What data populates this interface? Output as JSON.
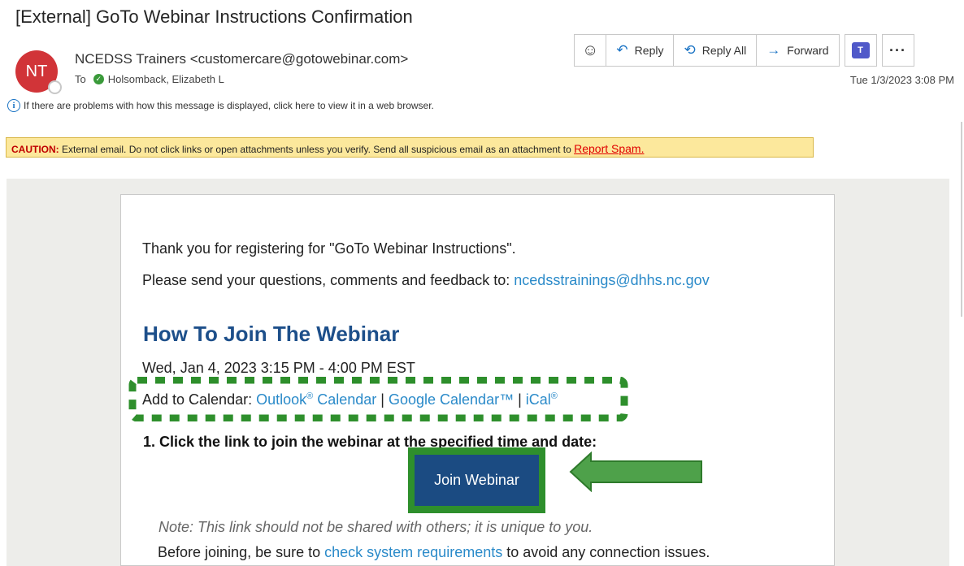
{
  "message": {
    "subject": "[External] GoTo Webinar Instructions Confirmation",
    "avatar_initials": "NT",
    "sender": "NCEDSS Trainers <customercare@gotowebinar.com>",
    "to_label": "To",
    "recipient": "Holsomback, Elizabeth L",
    "date": "Tue 1/3/2023 3:08 PM",
    "info_text": "If there are problems with how this message is displayed, click here to view it in a web browser."
  },
  "toolbar": {
    "emoji_icon": "smiley-icon",
    "reply_label": "Reply",
    "reply_all_label": "Reply All",
    "forward_label": "Forward",
    "teams_icon": "teams-icon",
    "more_icon": "more-icon"
  },
  "caution": {
    "label": "CAUTION:",
    "text": " External email. Do not click links or open attachments unless you verify. Send all suspicious email as an attachment to ",
    "link": "Report Spam."
  },
  "email_body": {
    "thanks": "Thank you for registering for \"GoTo Webinar Instructions\".",
    "questions_prefix": "Please send your questions, comments and feedback to: ",
    "questions_email": "ncedsstrainings@dhhs.nc.gov",
    "heading": "How To Join The Webinar",
    "datetime": "Wed, Jan 4, 2023 3:15 PM - 4:00 PM EST",
    "calendar_prefix": "Add to Calendar: ",
    "outlook_link": "Outlook",
    "outlook_suffix": " Calendar",
    "reg_mark": "®",
    "sep": " | ",
    "google_link": "Google Calendar™",
    "ical_link": "iCal",
    "step1": "1. Click the link to join the webinar at the specified time and date:",
    "join_label": "Join Webinar",
    "note": "Note: This link should not be shared with others; it is unique to you.",
    "before_prefix": "Before joining, be sure to ",
    "before_link": "check system requirements",
    "before_suffix": " to avoid any connection issues."
  },
  "annotations": {
    "highlight_color": "#2e8f2c",
    "arrow_color": "#2e8f2c"
  }
}
